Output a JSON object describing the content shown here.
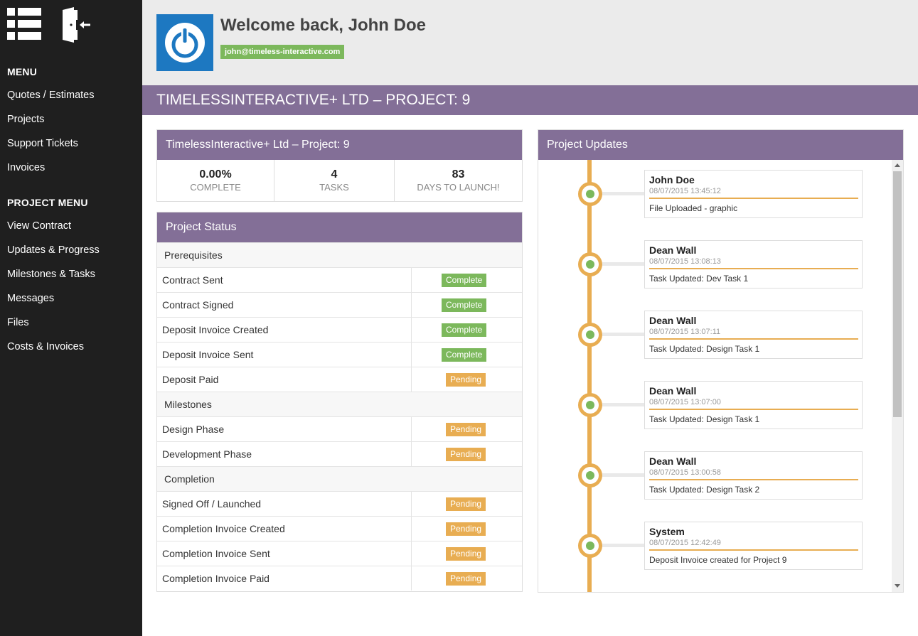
{
  "sidebar": {
    "menu_heading": "MENU",
    "menu_items": [
      "Quotes / Estimates",
      "Projects",
      "Support Tickets",
      "Invoices"
    ],
    "project_menu_heading": "PROJECT MENU",
    "project_menu_items": [
      "View Contract",
      "Updates & Progress",
      "Milestones & Tasks",
      "Messages",
      "Files",
      "Costs & Invoices"
    ]
  },
  "header": {
    "welcome": "Welcome back, John Doe",
    "email": "john@timeless-interactive.com"
  },
  "page_title": "TIMELESSINTERACTIVE+ LTD – PROJECT: 9",
  "summary": {
    "title": "TimelessInteractive+ Ltd – Project: 9",
    "stats": [
      {
        "value": "0.00%",
        "label": "COMPLETE"
      },
      {
        "value": "4",
        "label": "TASKS"
      },
      {
        "value": "83",
        "label": "DAYS TO LAUNCH!"
      }
    ]
  },
  "status": {
    "title": "Project Status",
    "groups": [
      {
        "name": "Prerequisites",
        "items": [
          {
            "name": "Contract Sent",
            "status": "Complete"
          },
          {
            "name": "Contract Signed",
            "status": "Complete"
          },
          {
            "name": "Deposit Invoice Created",
            "status": "Complete"
          },
          {
            "name": "Deposit Invoice Sent",
            "status": "Complete"
          },
          {
            "name": "Deposit Paid",
            "status": "Pending"
          }
        ]
      },
      {
        "name": "Milestones",
        "items": [
          {
            "name": "Design Phase",
            "status": "Pending"
          },
          {
            "name": "Development Phase",
            "status": "Pending"
          }
        ]
      },
      {
        "name": "Completion",
        "items": [
          {
            "name": "Signed Off / Launched",
            "status": "Pending"
          },
          {
            "name": "Completion Invoice Created",
            "status": "Pending"
          },
          {
            "name": "Completion Invoice Sent",
            "status": "Pending"
          },
          {
            "name": "Completion Invoice Paid",
            "status": "Pending"
          }
        ]
      }
    ]
  },
  "updates": {
    "title": "Project Updates",
    "items": [
      {
        "author": "John Doe",
        "time": "08/07/2015 13:45:12",
        "text": "File Uploaded - graphic"
      },
      {
        "author": "Dean Wall",
        "time": "08/07/2015 13:08:13",
        "text": "Task Updated: Dev Task 1"
      },
      {
        "author": "Dean Wall",
        "time": "08/07/2015 13:07:11",
        "text": "Task Updated: Design Task 1"
      },
      {
        "author": "Dean Wall",
        "time": "08/07/2015 13:07:00",
        "text": "Task Updated: Design Task 1"
      },
      {
        "author": "Dean Wall",
        "time": "08/07/2015 13:00:58",
        "text": "Task Updated: Design Task 2"
      },
      {
        "author": "System",
        "time": "08/07/2015 12:42:49",
        "text": "Deposit Invoice created for Project 9"
      }
    ]
  },
  "colors": {
    "sidebar_bg": "#1f1f1f",
    "accent_purple": "#836f97",
    "complete_green": "#7cb85c",
    "pending_orange": "#e8ad52",
    "avatar_blue": "#1d78c1"
  },
  "icons": {
    "menu": "list-menu-icon",
    "logout": "logout-door-icon",
    "avatar": "power-logo-icon"
  }
}
